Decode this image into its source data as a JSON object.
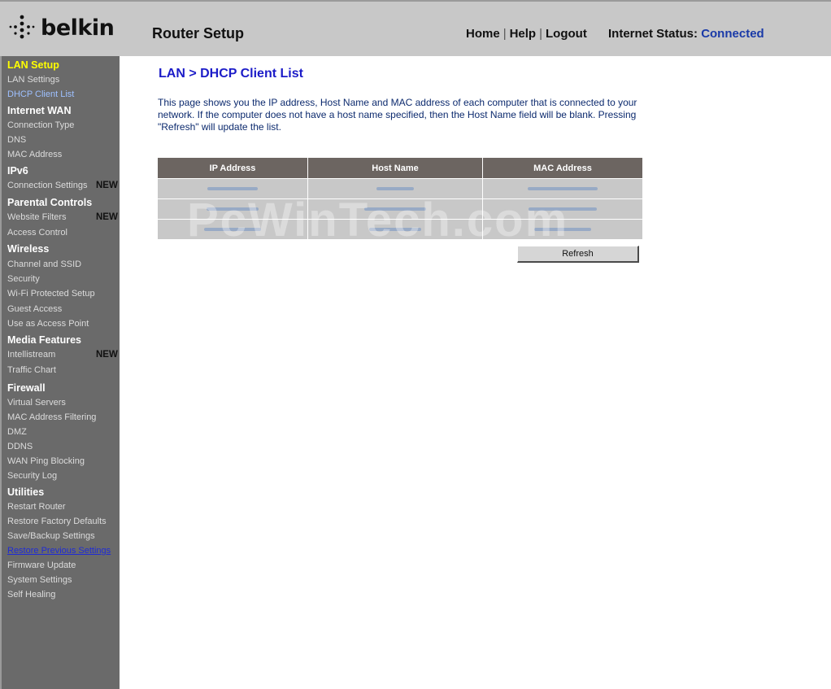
{
  "brand": {
    "name": "belkin",
    "icon": "belkin-dots-logo"
  },
  "header": {
    "app_title": "Router Setup",
    "nav": {
      "home": "Home",
      "help": "Help",
      "logout": "Logout",
      "separator": "|"
    },
    "status_label": "Internet Status:",
    "status_value": "Connected",
    "status_color": "#1a3aa8"
  },
  "sidebar": {
    "new_badge": "NEW",
    "sections": [
      {
        "heading": "LAN Setup",
        "items": [
          "LAN Settings",
          "DHCP Client List"
        ]
      },
      {
        "heading": "Internet WAN",
        "items": [
          "Connection Type",
          "DNS",
          "MAC Address"
        ]
      },
      {
        "heading": "IPv6",
        "items": [
          "Connection Settings"
        ]
      },
      {
        "heading": "Parental Controls",
        "items": [
          "Website Filters",
          "Access Control"
        ]
      },
      {
        "heading": "Wireless",
        "items": [
          "Channel and SSID",
          "Security",
          "Wi-Fi Protected Setup",
          "Guest Access",
          "Use as Access Point"
        ]
      },
      {
        "heading": "Media Features",
        "items": [
          "Intellistream",
          "Traffic Chart"
        ]
      },
      {
        "heading": "Firewall",
        "items": [
          "Virtual Servers",
          "MAC Address Filtering",
          "DMZ",
          "DDNS",
          "WAN Ping Blocking",
          "Security Log"
        ]
      },
      {
        "heading": "Utilities",
        "items": [
          "Restart Router",
          "Restore Factory Defaults",
          "Save/Backup Settings",
          "Restore Previous Settings",
          "Firmware Update",
          "System Settings",
          "Self Healing"
        ]
      }
    ]
  },
  "main": {
    "heading": "LAN > DHCP Client List",
    "description": "This page shows you the IP address, Host Name and MAC address of each computer that is connected to your network. If the computer does not have a host name specified, then the Host Name field will be blank. Pressing \"Refresh\" will update the list.",
    "table": {
      "headers": [
        "IP Address",
        "Host Name",
        "MAC Address"
      ],
      "row_count": 3
    },
    "watermark": "PcWinTech.com",
    "refresh_label": "Refresh"
  },
  "colors": {
    "header_bg": "#c8c8c8",
    "sidebar_bg": "#6a6a6a",
    "active_heading": "#ffff00",
    "current_item": "#9ec0ff",
    "page_heading": "#1c1cc8",
    "table_header_bg": "#6c6561",
    "table_cell_bg": "#c8c8c8"
  }
}
